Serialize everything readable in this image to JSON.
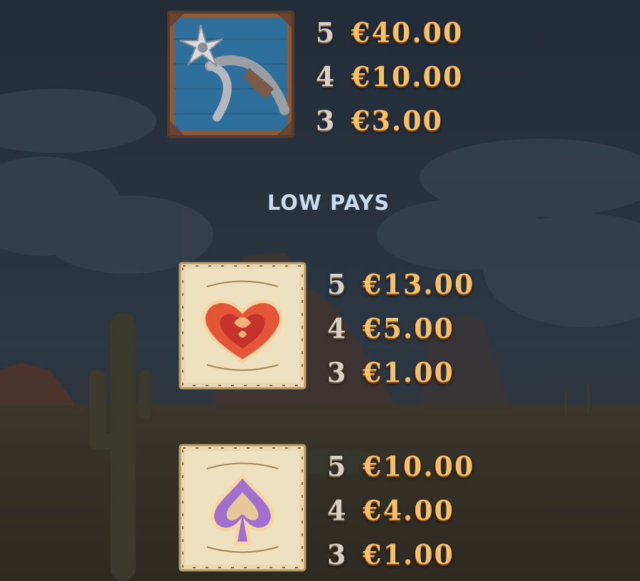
{
  "high_pay_symbol": {
    "icon": "spur-icon",
    "pays": [
      {
        "count": "5",
        "amount": "€40.00"
      },
      {
        "count": "4",
        "amount": "€10.00"
      },
      {
        "count": "3",
        "amount": "€3.00"
      }
    ]
  },
  "low_pays": {
    "title": "LOW PAYS",
    "symbols": [
      {
        "icon": "heart-icon",
        "pays": [
          {
            "count": "5",
            "amount": "€13.00"
          },
          {
            "count": "4",
            "amount": "€5.00"
          },
          {
            "count": "3",
            "amount": "€1.00"
          }
        ]
      },
      {
        "icon": "spade-icon",
        "pays": [
          {
            "count": "5",
            "amount": "€10.00"
          },
          {
            "count": "4",
            "amount": "€4.00"
          },
          {
            "count": "3",
            "amount": "€1.00"
          }
        ]
      }
    ]
  },
  "colors": {
    "sky": "#27313d",
    "amount_gold": "#f6c06a",
    "count_silver": "#d9cfc2",
    "title_blue": "#c8dcee",
    "heart_red": "#e4553a",
    "spade_purple": "#a36fcf"
  }
}
